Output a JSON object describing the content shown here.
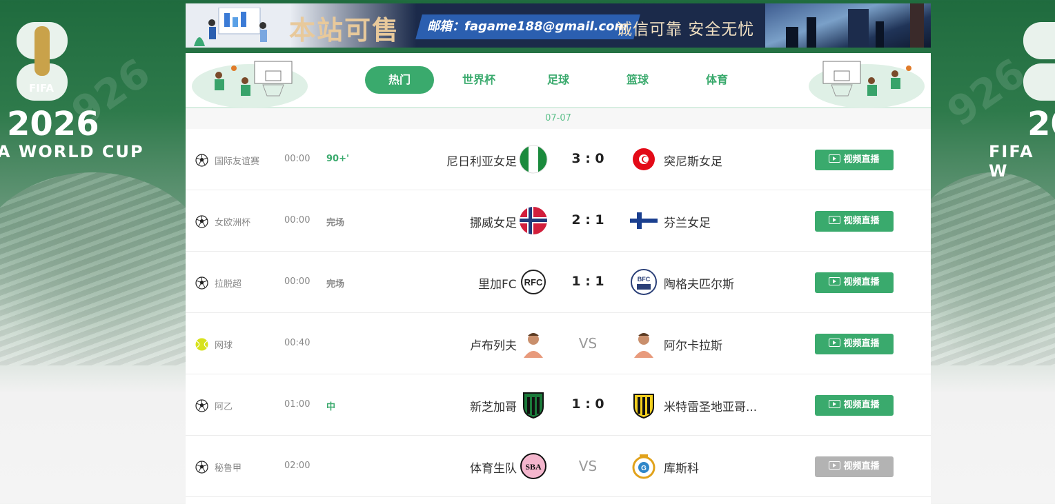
{
  "banner": {
    "title": "本站可售",
    "email": "邮箱：fagame188@gmail.com",
    "slogan": "诚信可靠 安全无忧"
  },
  "side": {
    "year": "2026",
    "fifa": "FIFA",
    "cup_left": "A WORLD CUP",
    "cup_right": "FIFA W"
  },
  "tabs": [
    {
      "label": "热门",
      "active": true
    },
    {
      "label": "世界杯",
      "active": false
    },
    {
      "label": "足球",
      "active": false
    },
    {
      "label": "篮球",
      "active": false
    },
    {
      "label": "体育",
      "active": false
    }
  ],
  "date": "07-07",
  "matches": [
    {
      "sport": "football",
      "league": "国际友谊赛",
      "time": "00:00",
      "status": "90+'",
      "home": "尼日利亚女足",
      "home_logo": "nigeria-flag-icon",
      "score": "3 : 0",
      "away": "突尼斯女足",
      "away_logo": "tunisia-flag-icon",
      "button": "视频直播",
      "button_enabled": true
    },
    {
      "sport": "football",
      "league": "女欧洲杯",
      "time": "00:00",
      "status": "完场",
      "home": "挪威女足",
      "home_logo": "norway-flag-icon",
      "score": "2 : 1",
      "away": "芬兰女足",
      "away_logo": "finland-flag-icon",
      "button": "视频直播",
      "button_enabled": true
    },
    {
      "sport": "football",
      "league": "拉脱超",
      "time": "00:00",
      "status": "完场",
      "home": "里加FC",
      "home_logo": "riga-fc-crest-icon",
      "score": "1 : 1",
      "away": "陶格夫匹尔斯",
      "away_logo": "bfc-daugavpils-crest-icon",
      "button": "视频直播",
      "button_enabled": true
    },
    {
      "sport": "tennis",
      "league": "网球",
      "time": "00:40",
      "status": "",
      "home": "卢布列夫",
      "home_logo": "player-avatar-icon",
      "score": "VS",
      "away": "阿尔卡拉斯",
      "away_logo": "player-avatar-icon",
      "button": "视频直播",
      "button_enabled": true
    },
    {
      "sport": "football",
      "league": "阿乙",
      "time": "01:00",
      "status": "中",
      "home": "新芝加哥",
      "home_logo": "nueva-chicago-crest-icon",
      "score": "1 : 0",
      "away": "米特雷圣地亚哥...",
      "away_logo": "mitre-crest-icon",
      "button": "视频直播",
      "button_enabled": true
    },
    {
      "sport": "football",
      "league": "秘鲁甲",
      "time": "02:00",
      "status": "",
      "home": "体育生队",
      "home_logo": "sba-crest-icon",
      "score": "VS",
      "away": "库斯科",
      "away_logo": "cusco-crest-icon",
      "button": "视频直播",
      "button_enabled": false
    }
  ]
}
